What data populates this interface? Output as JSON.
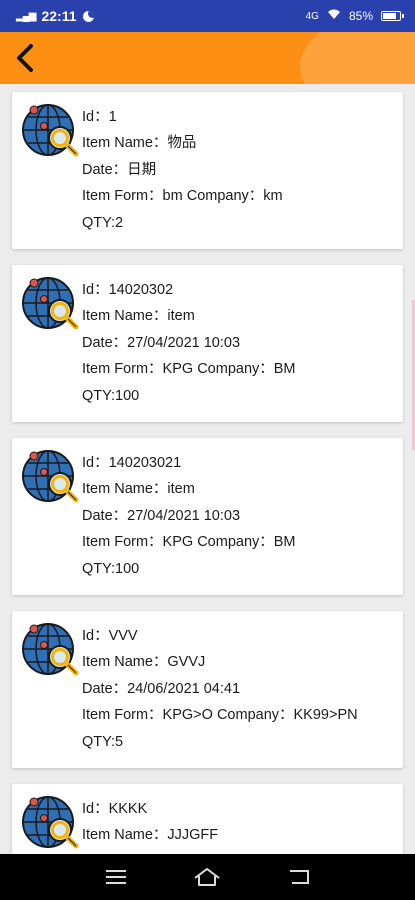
{
  "status_bar": {
    "network": "4G",
    "time": "22:11",
    "signal_label": "4G",
    "battery": "85%",
    "battery_level": 0.85
  },
  "header": {
    "back_icon": "chevron-left-icon",
    "accent_color": "#fd9014"
  },
  "items": [
    {
      "icon": "globe-search-icon",
      "lines": [
        "Id：1",
        "Item Name：物品",
        "Date：日期",
        "Item Form：bm Company：km",
        "QTY:2"
      ]
    },
    {
      "icon": "globe-search-icon",
      "lines": [
        "Id：14020302",
        "Item Name：item",
        "Date：27/04/2021 10:03",
        "Item Form：KPG Company：BM",
        "QTY:100"
      ]
    },
    {
      "icon": "globe-search-icon",
      "lines": [
        "Id：140203021",
        "Item Name：item",
        "Date：27/04/2021 10:03",
        "Item Form：KPG Company：BM",
        "QTY:100"
      ]
    },
    {
      "icon": "globe-search-icon",
      "lines": [
        "Id：VVV",
        "Item Name：GVVJ",
        "Date：24/06/2021 04:41",
        "Item Form：KPG>O Company：KK99>PN",
        "QTY:5"
      ]
    },
    {
      "icon": "globe-search-icon",
      "lines": [
        "Id：KKKK",
        "Item Name：JJJGFF",
        "",
        "",
        ""
      ]
    }
  ],
  "nav_bar": {
    "menu_icon": "menu-icon",
    "home_icon": "home-icon",
    "back_icon": "back-icon"
  }
}
